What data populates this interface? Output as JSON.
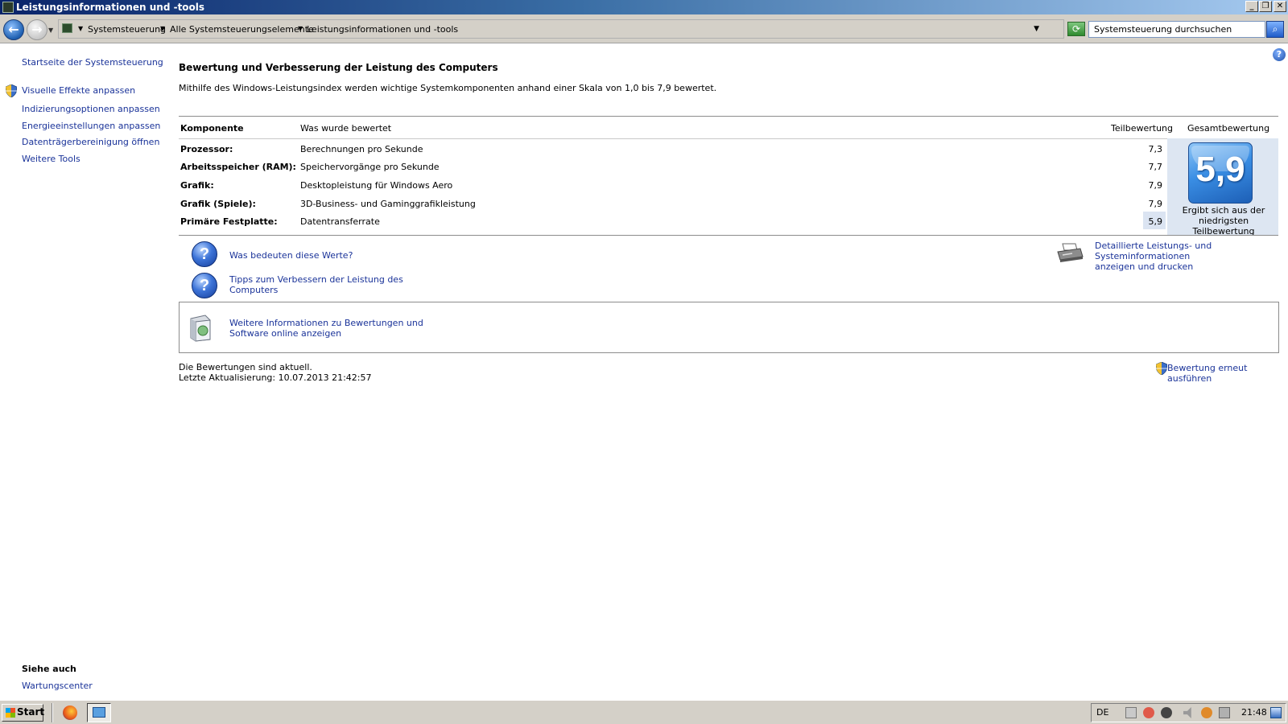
{
  "window": {
    "title": "Leistungsinformationen und -tools",
    "controls": {
      "minimize": "_",
      "restore": "❐",
      "close": "✕"
    }
  },
  "address": {
    "crumbs": [
      "Systemsteuerung",
      "Alle Systemsteuerungselemente",
      "Leistungsinformationen und -tools"
    ],
    "search_placeholder": "Systemsteuerung durchsuchen"
  },
  "leftnav": {
    "home": "Startseite der Systemsteuerung",
    "items": [
      "Visuelle Effekte anpassen",
      "Indizierungsoptionen anpassen",
      "Energieeinstellungen anpassen",
      "Datenträgerbereinigung öffnen",
      "Weitere Tools"
    ],
    "see_also_title": "Siehe auch",
    "see_also_link": "Wartungscenter"
  },
  "main": {
    "title": "Bewertung und Verbesserung der Leistung des Computers",
    "description": "Mithilfe des Windows-Leistungsindex werden wichtige Systemkomponenten anhand einer Skala von 1,0 bis 7,9 bewertet.",
    "table": {
      "headers": {
        "component": "Komponente",
        "rated": "Was wurde bewertet",
        "subscore": "Teilbewertung",
        "basescore": "Gesamtbewertung"
      },
      "rows": [
        {
          "component": "Prozessor:",
          "rated": "Berechnungen pro Sekunde",
          "score": "7,3"
        },
        {
          "component": "Arbeitsspeicher (RAM):",
          "rated": "Speichervorgänge pro Sekunde",
          "score": "7,7"
        },
        {
          "component": "Grafik:",
          "rated": "Desktopleistung für Windows Aero",
          "score": "7,9"
        },
        {
          "component": "Grafik (Spiele):",
          "rated": "3D-Business- und Gaminggrafikleistung",
          "score": "7,9"
        },
        {
          "component": "Primäre Festplatte:",
          "rated": "Datentransferrate",
          "score": "5,9"
        }
      ],
      "overall": {
        "value": "5,9",
        "caption_1": "Ergibt sich aus der",
        "caption_2": "niedrigsten",
        "caption_3": "Teilbewertung"
      }
    },
    "links": {
      "what_mean": "Was bedeuten diese Werte?",
      "tips_1": "Tipps zum Verbessern der Leistung des",
      "tips_2": "Computers",
      "details_1": "Detaillierte Leistungs- und Systeminformationen",
      "details_2": "anzeigen und drucken",
      "online_1": "Weitere Informationen zu Bewertungen und",
      "online_2": "Software online anzeigen"
    },
    "status": {
      "current": "Die Bewertungen sind aktuell.",
      "updated": "Letzte Aktualisierung: 10.07.2013 21:42:57",
      "rerun": "Bewertung erneut ausführen"
    }
  },
  "taskbar": {
    "start": "Start",
    "language": "DE",
    "clock": "21:48"
  },
  "colors": {
    "link": "#1a3399",
    "titlebar": "#0a246a",
    "badge": "#3a8ee4"
  }
}
